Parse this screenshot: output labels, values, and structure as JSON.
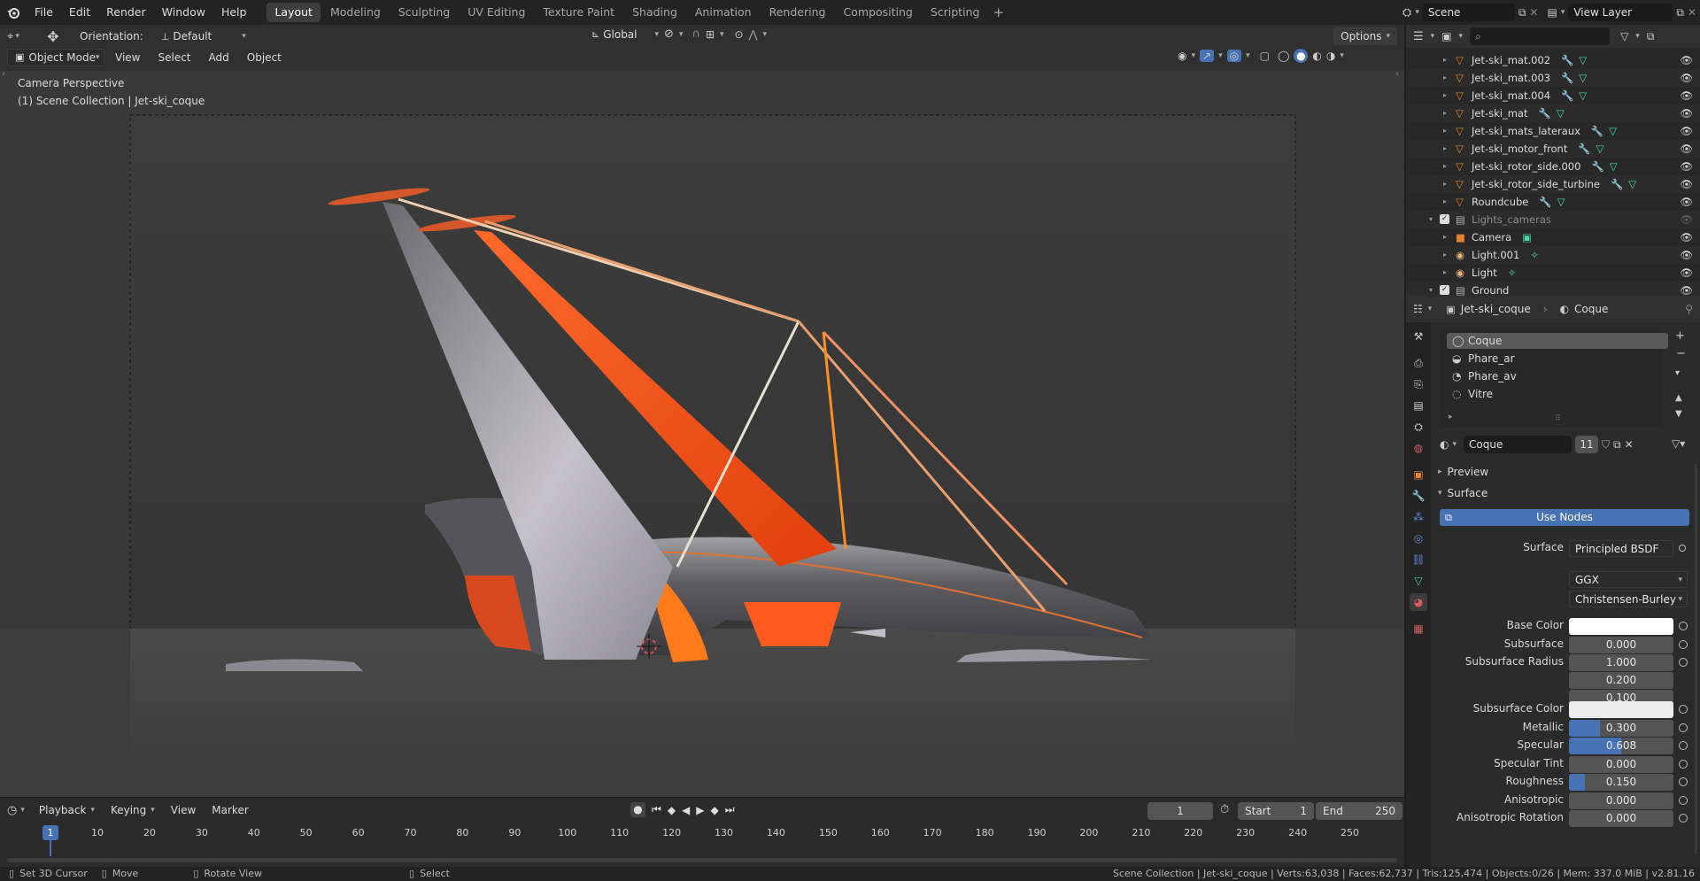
{
  "menu": {
    "file": "File",
    "edit": "Edit",
    "render": "Render",
    "window": "Window",
    "help": "Help"
  },
  "workspaces": [
    "Layout",
    "Modeling",
    "Sculpting",
    "UV Editing",
    "Texture Paint",
    "Shading",
    "Animation",
    "Rendering",
    "Compositing",
    "Scripting"
  ],
  "active_workspace": "Layout",
  "scene": {
    "name": "Scene",
    "view_layer": "View Layer"
  },
  "toolbar": {
    "orientation_label": "Orientation:",
    "orientation_value": "Default",
    "transform_space": "Global",
    "options": "Options"
  },
  "viewport_header": {
    "mode": "Object Mode",
    "view": "View",
    "select": "Select",
    "add": "Add",
    "object": "Object"
  },
  "viewport": {
    "title": "Camera Perspective",
    "subtitle": "(1) Scene Collection | Jet-ski_coque"
  },
  "outliner": {
    "rows": [
      {
        "label": "Jet-ski_mat.002",
        "type": "object"
      },
      {
        "label": "Jet-ski_mat.003",
        "type": "object"
      },
      {
        "label": "Jet-ski_mat.004",
        "type": "object"
      },
      {
        "label": "Jet-ski_mat",
        "type": "object"
      },
      {
        "label": "Jet-ski_mats_lateraux",
        "type": "object"
      },
      {
        "label": "Jet-ski_motor_front",
        "type": "object"
      },
      {
        "label": "Jet-ski_rotor_side.000",
        "type": "object"
      },
      {
        "label": "Jet-ski_rotor_side_turbine",
        "type": "object"
      },
      {
        "label": "Roundcube",
        "type": "object"
      },
      {
        "label": "Lights_cameras",
        "type": "collection"
      },
      {
        "label": "Camera",
        "type": "camera"
      },
      {
        "label": "Light.001",
        "type": "light"
      },
      {
        "label": "Light",
        "type": "light"
      },
      {
        "label": "Ground",
        "type": "collection"
      }
    ]
  },
  "properties": {
    "object_name": "Jet-ski_coque",
    "material_name": "Coque",
    "slots": [
      "Coque",
      "Phare_ar",
      "Phare_av",
      "Vitre"
    ],
    "material_field": "Coque",
    "user_count": "11",
    "preview_label": "Preview",
    "surface_label": "Surface",
    "use_nodes": "Use Nodes",
    "surface_shader_label": "Surface",
    "surface_shader": "Principled BSDF",
    "distribution": "GGX",
    "subsurface_method": "Christensen-Burley",
    "params": {
      "base_color": {
        "label": "Base Color"
      },
      "subsurface": {
        "label": "Subsurface",
        "value": "0.000"
      },
      "subsurface_radius": {
        "label": "Subsurface Radius",
        "values": [
          "1.000",
          "0.200",
          "0.100"
        ]
      },
      "subsurface_color": {
        "label": "Subsurface Color"
      },
      "metallic": {
        "label": "Metallic",
        "value": "0.300",
        "fraction": 0.3
      },
      "specular": {
        "label": "Specular",
        "value": "0.608",
        "fraction": 0.5
      },
      "specular_tint": {
        "label": "Specular Tint",
        "value": "0.000"
      },
      "roughness": {
        "label": "Roughness",
        "value": "0.150",
        "fraction": 0.15
      },
      "anisotropic": {
        "label": "Anisotropic",
        "value": "0.000"
      },
      "anisotropic_rotation": {
        "label": "Anisotropic Rotation",
        "value": "0.000"
      }
    }
  },
  "timeline": {
    "playback": "Playback",
    "keying": "Keying",
    "view": "View",
    "marker": "Marker",
    "current_frame": "1",
    "start_label": "Start",
    "start": "1",
    "end_label": "End",
    "end": "250",
    "ruler": [
      "1",
      "10",
      "20",
      "30",
      "40",
      "50",
      "60",
      "70",
      "80",
      "90",
      "100",
      "110",
      "120",
      "130",
      "140",
      "150",
      "160",
      "170",
      "180",
      "190",
      "200",
      "210",
      "220",
      "230",
      "240",
      "250"
    ]
  },
  "statusbar": {
    "left1": "Set 3D Cursor",
    "left2": "Move",
    "left3": "Rotate View",
    "left4": "Select",
    "right": "Scene Collection | Jet-ski_coque | Verts:63,038 | Faces:62,737 | Tris:125,474 | Objects:0/26 | Mem: 337.0 MiB | v2.81.16"
  },
  "colors": {
    "accent": "#4772b3",
    "orange": "#ff5b1e",
    "object_icon": "#e8832a",
    "light_icon": "#e8b27a",
    "mesh_icon": "#4ad8a8"
  }
}
